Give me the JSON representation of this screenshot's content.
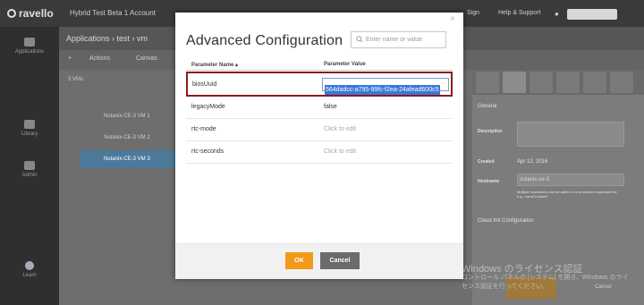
{
  "app": {
    "logo": "ravello",
    "top_title": "Hybrid Test Beta 1 Account",
    "top_links": [
      "Sign",
      "Help & Support"
    ],
    "user_icon": "person-icon"
  },
  "sidebar": {
    "items": [
      {
        "label": "Applications",
        "icon": "apps-icon"
      },
      {
        "label": "Library",
        "icon": "library-icon"
      },
      {
        "label": "Admin",
        "icon": "admin-icon"
      },
      {
        "label": "Learn",
        "icon": "bulb-icon"
      }
    ]
  },
  "background": {
    "app_title": "Applications › test › vm",
    "toolbar": [
      "Actions",
      "Canvas"
    ],
    "vm_count": "3 VMs",
    "vm_rows": [
      "Nutanix-CE-3 VM 1",
      "Nutanix-CE-3 VM 2",
      "Nutanix-CE-3 VM 3"
    ],
    "right_section": "General",
    "fields": [
      {
        "label": "Description",
        "value": ""
      },
      {
        "label": "Created",
        "value": "Apr 12, 2016"
      },
      {
        "label": "Hostname",
        "value": "nutanix-ce-3"
      }
    ],
    "hostname_hint": "Multiple hostnames can be added in a semicolon separated list, e.g.: name1;name2",
    "cloud_init": "Cloud Init Configuration"
  },
  "modal": {
    "title": "Advanced Configuration",
    "close_glyph": "×",
    "search_placeholder": "Enter name or value",
    "col_name": "Parameter Name ▴",
    "col_value": "Parameter Value",
    "params": [
      {
        "name": "biosUuid",
        "value": "564dadcc-a795-99fc-f2ea-24afead600c5",
        "editing": true
      },
      {
        "name": "legacyMode",
        "value": "false"
      },
      {
        "name": "rtc-mode",
        "value": "Click to edit"
      },
      {
        "name": "rtc-seconds",
        "value": "Click to edit"
      }
    ],
    "ok_label": "OK",
    "cancel_label": "Cancel"
  },
  "watermark": {
    "line1": "Windows のライセンス認証",
    "line2": "コントロール パネルの [システム] を開き、Windows のライ",
    "line3": "センス認証を行ってください。"
  },
  "colors": {
    "accent_orange": "#f39a1b",
    "highlight_border": "#8b1a1a",
    "selection_blue": "#3a78d8"
  }
}
